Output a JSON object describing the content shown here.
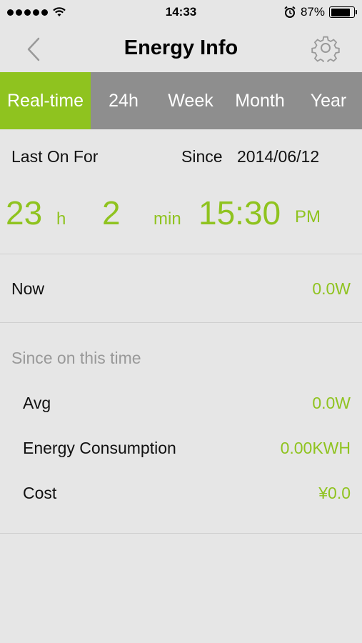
{
  "status_bar": {
    "time": "14:33",
    "battery_percent": "87%",
    "battery_level": 0.87,
    "icons": [
      "signal-dots",
      "wifi-icon",
      "alarm-icon",
      "battery-icon"
    ]
  },
  "nav": {
    "title": "Energy Info",
    "back_icon": "chevron-left-icon",
    "settings_icon": "gear-icon"
  },
  "tabs": [
    {
      "label": "Real-time",
      "active": true
    },
    {
      "label": "24h",
      "active": false
    },
    {
      "label": "Week",
      "active": false
    },
    {
      "label": "Month",
      "active": false
    },
    {
      "label": "Year",
      "active": false
    }
  ],
  "last_on": {
    "label": "Last On For",
    "since_label": "Since",
    "since_date": "2014/06/12",
    "hours": "23",
    "hours_unit": "h",
    "minutes": "2",
    "minutes_unit": "min",
    "time": "15:30",
    "ampm": "PM"
  },
  "now": {
    "label": "Now",
    "value": "0.0W"
  },
  "since_section": {
    "header": "Since on this time",
    "avg": {
      "label": "Avg",
      "value": "0.0W"
    },
    "energy": {
      "label": "Energy Consumption",
      "value": "0.00KWH"
    },
    "cost": {
      "label": "Cost",
      "value": "¥0.0"
    }
  },
  "colors": {
    "accent": "#8fc31f",
    "tab_bar": "#8e8e8e",
    "background": "#e6e6e6",
    "muted_text": "#999999"
  }
}
